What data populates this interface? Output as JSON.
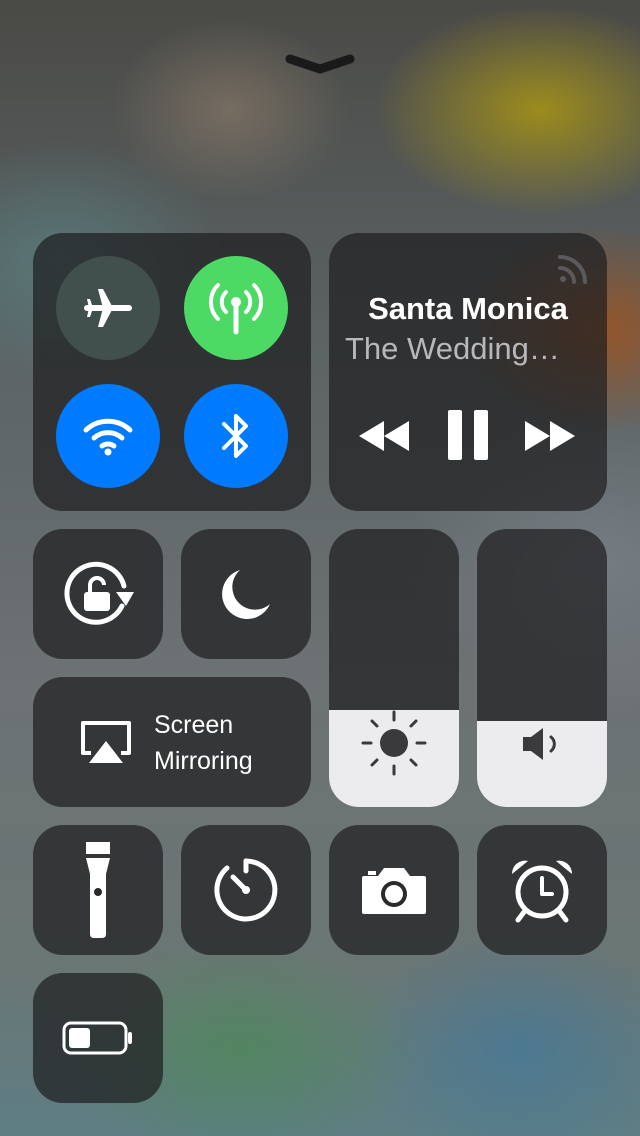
{
  "colors": {
    "tile": "rgba(30,30,32,0.72)",
    "airplane_off": "#41504d",
    "cellular_on": "#4cd964",
    "wifi_on": "#007aff",
    "bluetooth_on": "#007aff",
    "slider_fill": "#ececef"
  },
  "handle": {
    "icon": "chevron-down-icon"
  },
  "connectivity": {
    "airplane": {
      "icon": "airplane-icon",
      "on": false
    },
    "cellular": {
      "icon": "antenna-icon",
      "on": true
    },
    "wifi": {
      "icon": "wifi-icon",
      "on": true
    },
    "bluetooth": {
      "icon": "bluetooth-icon",
      "on": true
    }
  },
  "now_playing": {
    "title": "Santa Monica",
    "subtitle": "The Wedding…",
    "airplay_icon": "airplay-audio-icon",
    "controls": [
      "rewind-icon",
      "pause-icon",
      "fast-forward-icon"
    ]
  },
  "toggles": {
    "orientation_lock": {
      "icon": "orientation-lock-icon"
    },
    "do_not_disturb": {
      "icon": "moon-icon"
    }
  },
  "screen_mirroring": {
    "line1": "Screen",
    "line2": "Mirroring",
    "icon": "airplay-video-icon"
  },
  "sliders": {
    "brightness": {
      "icon": "sun-icon",
      "level": 0.35
    },
    "volume": {
      "icon": "speaker-icon",
      "level": 0.31
    }
  },
  "shortcuts": [
    "flashlight-icon",
    "timer-icon",
    "camera-icon",
    "alarm-clock-icon"
  ],
  "low_power": {
    "icon": "battery-icon",
    "level": 0.4
  }
}
